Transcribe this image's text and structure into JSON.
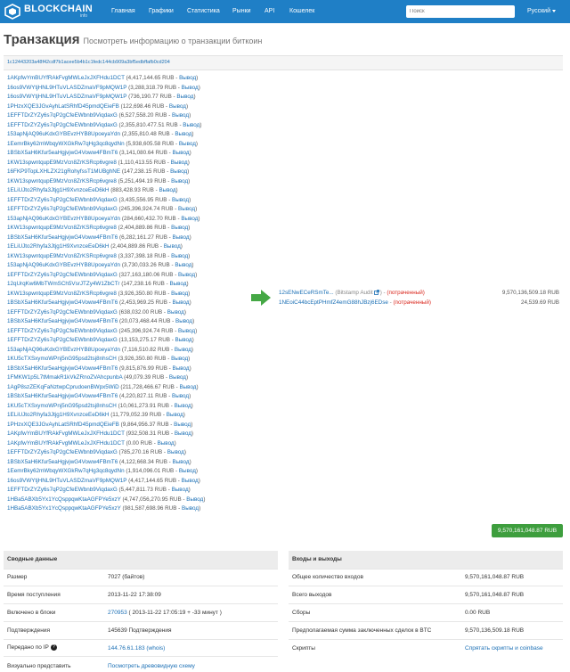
{
  "nav": {
    "brand": "BLOCKCHAIN",
    "brand_sub": "info",
    "links": [
      "Главная",
      "Графики",
      "Статистика",
      "Рынки",
      "API",
      "Кошелек"
    ],
    "search_placeholder": "Поиск",
    "language": "Русский"
  },
  "page": {
    "title": "Транзакция",
    "subtitle": "Посмотреть информацию о транзакции биткоин"
  },
  "tx_hash": "1c12443203a48f42cdf7b1acee5b4b1c1fedc144cb909a3bf5edbffafb0cd204",
  "spent_label": "Вывод",
  "inputs": [
    {
      "address": "1AKpfwYmBUYfRAkFvgMWLeJxJXFHdu1DCT",
      "amount": "(4,417,144.65 RUB -"
    },
    {
      "address": "16os9VWYtjHNL9HTuVLASDZmaVF9pMQW1P",
      "amount": "(3,288,318.79 RUB -"
    },
    {
      "address": "16os9VWYtjHNL9HTuVLASDZmaVF9pMQW1P",
      "amount": "(736,190.77 RUB -"
    },
    {
      "address": "1PHzxXQE3JGvAyhLatSRhfD45pmdQEieFB",
      "amount": "(122,698.46 RUB -"
    },
    {
      "address": "1EFFTDrZYZy6s7qP2gCfeEWbnb9ViqdaxG",
      "amount": "(6,527,558.20 RUB -"
    },
    {
      "address": "1EFFTDrZYZy6s7qP2gCfeEWbnb9ViqdaxG",
      "amount": "(2,355,810.477.51 RUB -"
    },
    {
      "address": "153apNjAQ96uKdxGYBEvzHYB8UpoeyaYdn",
      "amount": "(2,355,810.48 RUB -"
    },
    {
      "address": "1EemrBky62mWbqyWXGkRw7qHg3qc8qydNn",
      "amount": "(5,938,605.58 RUB -"
    },
    {
      "address": "1BSbX5aH6Kfur5eaHgjvjwG4Voww4FBmT6",
      "amount": "(3,141,080.64 RUB -"
    },
    {
      "address": "1KW13spwntqupE9MzVcn8ZrKSRcp6vgre8",
      "amount": "(1,110,413.55 RUB -"
    },
    {
      "address": "16FKP9TopLXHLZX21gRohyfssT1MUBghNE",
      "amount": "(147,238.15 RUB -"
    },
    {
      "address": "1KW13spwntqupE9MzVcn8ZrKSRcp6vgre8",
      "amount": "(5,251,494.19 RUB -"
    },
    {
      "address": "1ELiUJto2Rhyfa3Jtjg1H9XvnzceEeD6kH",
      "amount": "(883,428.93 RUB -"
    },
    {
      "address": "1EFFTDrZYZy6s7qP2gCfeEWbnb9ViqdaxG",
      "amount": "(3,435,556.95 RUB -"
    },
    {
      "address": "1EFFTDrZYZy6s7qP2gCfeEWbnb9ViqdaxG",
      "amount": "(245,396,924.74 RUB -"
    },
    {
      "address": "153apNjAQ96uKdxGYBEvzHYB8UpoeyaYdn",
      "amount": "(284,660,432.70 RUB -"
    },
    {
      "address": "1KW13spwntqupE9MzVcn8ZrKSRcp6vgre8",
      "amount": "(2,404,889.86 RUB -"
    },
    {
      "address": "1BSbX5aH6Kfur5eaHgjvjwG4Voww4FBmT6",
      "amount": "(6,282,161.27 RUB -"
    },
    {
      "address": "1ELiUJto2Rhyfa3Jtjg1H9XvnzceEeD6kH",
      "amount": "(2,404,889.86 RUB -"
    },
    {
      "address": "1KW13spwntqupE9MzVcn8ZrKSRcp6vgre8",
      "amount": "(3,337,398.18 RUB -"
    },
    {
      "address": "153apNjAQ96uKdxGYBEvzHYB8UpoeyaYdn",
      "amount": "(3,730,033.26 RUB -"
    },
    {
      "address": "1EFFTDrZYZy6s7qP2gCfeEWbnb9ViqdaxG",
      "amount": "(327,163,180.06 RUB -"
    },
    {
      "address": "12qUrqKw6MbTWmSCh5VsrJTZy4W1ZbCTr",
      "amount": "(147,238.16 RUB -"
    },
    {
      "address": "1KW13spwntqupE9MzVcn8ZrKSRcp6vgre8",
      "amount": "(3,926,350.80 RUB -"
    },
    {
      "address": "1BSbX5aH6Kfur5eaHgjvjwG4Voww4FBmT6",
      "amount": "(2,453,969.25 RUB -"
    },
    {
      "address": "1EFFTDrZYZy6s7qP2gCfeEWbnb9ViqdaxG",
      "amount": "(638,032.00 RUB -"
    },
    {
      "address": "1BSbX5aH6Kfur5eaHgjvjwG4Voww4FBmT6",
      "amount": "(20,073,468.44 RUB -"
    },
    {
      "address": "1EFFTDrZYZy6s7qP2gCfeEWbnb9ViqdaxG",
      "amount": "(245,396,924.74 RUB -"
    },
    {
      "address": "1EFFTDrZYZy6s7qP2gCfeEWbnb9ViqdaxG",
      "amount": "(13,153,275.17 RUB -"
    },
    {
      "address": "153apNjAQ96uKdxGYBEvzHYB8UpoeyaYdn",
      "amount": "(7,116,510.82 RUB -"
    },
    {
      "address": "1KU5cTXSxymoWPnj5nG95psd2tsj8nhsCH",
      "amount": "(3,926,350.80 RUB -"
    },
    {
      "address": "1BSbX5aH6Kfur5eaHgjvjwG4Voww4FBmT6",
      "amount": "(9,815,876.99 RUB -"
    },
    {
      "address": "1FMKW1p5L7tMmakR1kVkZRnoZVAhcpunbA",
      "amount": "(49,079.39 RUB -"
    },
    {
      "address": "1AgP8szZEKqFaNztwpCprudoenBWpx5WiD",
      "amount": "(211,728,466.67 RUB -"
    },
    {
      "address": "1BSbX5aH6Kfur5eaHgjvjwG4Voww4FBmT6",
      "amount": "(4,220,827.11 RUB -"
    },
    {
      "address": "1KU5cTXSxymoWPnj5nG95psd2tsj8nhsCH",
      "amount": "(10,061,273.91 RUB -"
    },
    {
      "address": "1ELiUJto2Rhyfa3Jtjg1H9XvnzceEeD6kH",
      "amount": "(11,779,052.39 RUB -"
    },
    {
      "address": "1PHzxXQE3JGvAyhLatSRhfD45pmdQEieFB",
      "amount": "(9,864,956.37 RUB -"
    },
    {
      "address": "1AKpfwYmBUYfRAkFvgMWLeJxJXFHdu1DCT",
      "amount": "(932,508.31 RUB -"
    },
    {
      "address": "1AKpfwYmBUYfRAkFvgMWLeJxJXFHdu1DCT",
      "amount": "(0.00 RUB -"
    },
    {
      "address": "1EFFTDrZYZy6s7qP2gCfeEWbnb9ViqdaxG",
      "amount": "(785,270.16 RUB -"
    },
    {
      "address": "1BSbX5aH6Kfur5eaHgjvjwG4Voww4FBmT6",
      "amount": "(4,122,668.34 RUB -"
    },
    {
      "address": "1EemrBky62mWbqyWXGkRw7qHg3qc8qydNn",
      "amount": "(1,914,096.01 RUB -"
    },
    {
      "address": "16os9VWYtjHNL9HTuVLASDZmaVF9pMQW1P",
      "amount": "(4,417,144.65 RUB -"
    },
    {
      "address": "1EFFTDrZYZy6s7qP2gCfeEWbnb9ViqdaxG",
      "amount": "(5,447,811.73 RUB -"
    },
    {
      "address": "1HBa5ABXb5Yx1YcQsppqwKtaAGFPYe5xzY",
      "amount": "(4,747,056,270.95 RUB -"
    },
    {
      "address": "1HBa5ABXb5Yx1YcQsppqwKtaAGFPYe5xzY",
      "amount": "(981,587,698.96 RUB -"
    }
  ],
  "outputs": [
    {
      "address": "12sENwECeRSmTe...",
      "tag": "(Bitstamp Audit",
      "link_icon": "external-link-icon",
      "status_sep": ") -",
      "status": "(потраченный)",
      "value": "9,570,136,509.18 RUB"
    },
    {
      "address": "1NEoiC44bcEptPHmfZ4emG88hJBzj6EDse",
      "tag": "",
      "link_icon": "",
      "status_sep": "-",
      "status": "(потраченный)",
      "value": "24,539.69 RUB"
    }
  ],
  "total_button": "9,570,161,048.87 RUB",
  "summary": {
    "title": "Сводные данные",
    "size_label": "Размер",
    "size_value": "7027 (байтов)",
    "received_label": "Время поступления",
    "received_value": "2013-11-22 17:38:09",
    "block_label": "Включено в блоки",
    "block_link": "270953",
    "block_extra": "( 2013-11-22 17:05:19 + -33 минут )",
    "confirm_label": "Подтверждения",
    "confirm_value": "145639 Подтверждения",
    "relayed_label": "Передано по IP",
    "relayed_value": "144.76.61.183 (whois)",
    "visual_label": "Визуально представить",
    "visual_value": "Посмотреть древовидную схему"
  },
  "io": {
    "title": "Входы и выходы",
    "total_in_label": "Общее количество входов",
    "total_in_value": "9,570,161,048.87 RUB",
    "total_out_label": "Всего выходов",
    "total_out_value": "9,570,161,048.87 RUB",
    "fees_label": "Сборы",
    "fees_value": "0.00 RUB",
    "estimated_label": "Предполагаемая сумма заключенных сделок в BTC",
    "estimated_value": "9,570,136,509.18 RUB",
    "scripts_label": "Скрипты",
    "scripts_value": "Спрятать скрипты и coinbase"
  },
  "colors": {
    "navbar": "#1f7fc6",
    "link": "#1a6fb5",
    "unspent_red": "#d9261c",
    "total_green": "#3e9e3e",
    "arrow_green": "#45a845"
  }
}
